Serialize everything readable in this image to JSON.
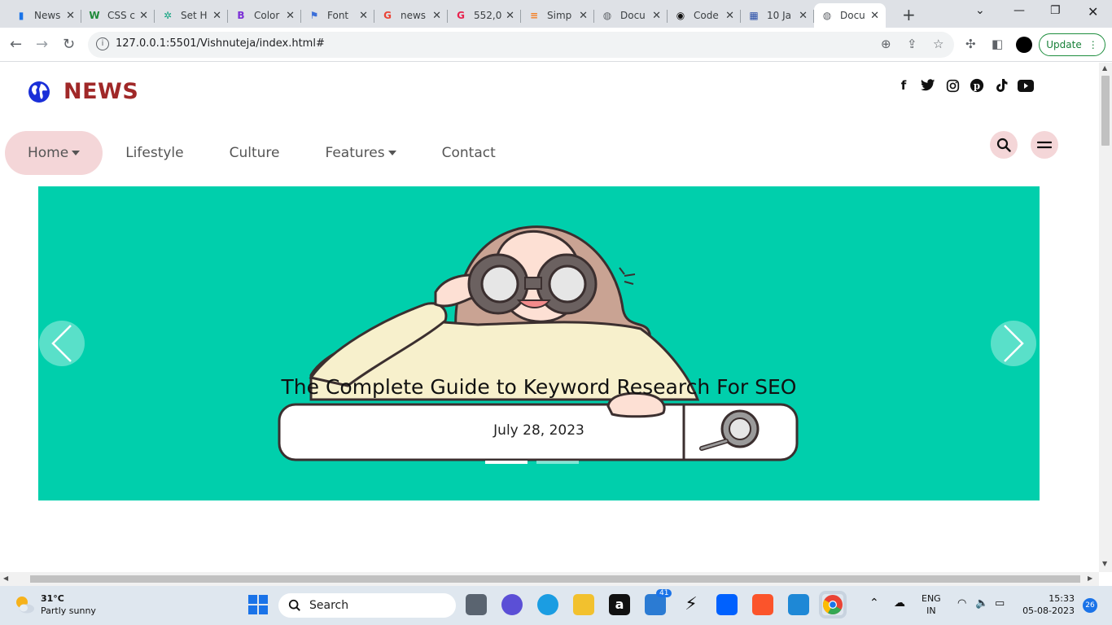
{
  "browser": {
    "tabs": [
      {
        "label": "News",
        "color": "#1a73e8",
        "glyph": "▮"
      },
      {
        "label": "CSS c",
        "color": "#1f8a3a",
        "glyph": "W"
      },
      {
        "label": "Set H",
        "color": "#10a37f",
        "glyph": "✲"
      },
      {
        "label": "Color",
        "color": "#7b2fd6",
        "glyph": "B"
      },
      {
        "label": "Font",
        "color": "#3b6fd9",
        "glyph": "⚑"
      },
      {
        "label": "news",
        "color": "#ea4335",
        "glyph": "G"
      },
      {
        "label": "552,0",
        "color": "#e8244f",
        "glyph": "G"
      },
      {
        "label": "Simp",
        "color": "#f48024",
        "glyph": "≡"
      },
      {
        "label": "Docu",
        "color": "#5f6368",
        "glyph": "◍"
      },
      {
        "label": "Code",
        "color": "#111111",
        "glyph": "◉"
      },
      {
        "label": "10 Ja",
        "color": "#2a4fa8",
        "glyph": "▦"
      },
      {
        "label": "Docu",
        "color": "#5f6368",
        "glyph": "◍"
      }
    ],
    "url": "127.0.0.1:5501/Vishnuteja/index.html#",
    "update_label": "Update"
  },
  "site": {
    "brand": "NEWS",
    "social_icons": [
      "facebook-icon",
      "twitter-icon",
      "instagram-icon",
      "pinterest-icon",
      "tiktok-icon",
      "youtube-icon"
    ],
    "nav": [
      {
        "label": "Home",
        "dropdown": true,
        "active": true
      },
      {
        "label": "Lifestyle",
        "dropdown": false,
        "active": false
      },
      {
        "label": "Culture",
        "dropdown": false,
        "active": false
      },
      {
        "label": "Features",
        "dropdown": true,
        "active": false
      },
      {
        "label": "Contact",
        "dropdown": false,
        "active": false
      }
    ],
    "carousel": {
      "title": "The Complete Guide to Keyword Research For SEO",
      "date": "July 28, 2023",
      "slide_count": 2,
      "active_slide": 0,
      "background": "#00cfac"
    }
  },
  "taskbar": {
    "weather_temp": "31°C",
    "weather_desc": "Partly sunny",
    "search_placeholder": "Search",
    "mail_badge": "41",
    "lang": "ENG",
    "region": "IN",
    "time": "15:33",
    "date": "05-08-2023",
    "notif_count": "26"
  }
}
